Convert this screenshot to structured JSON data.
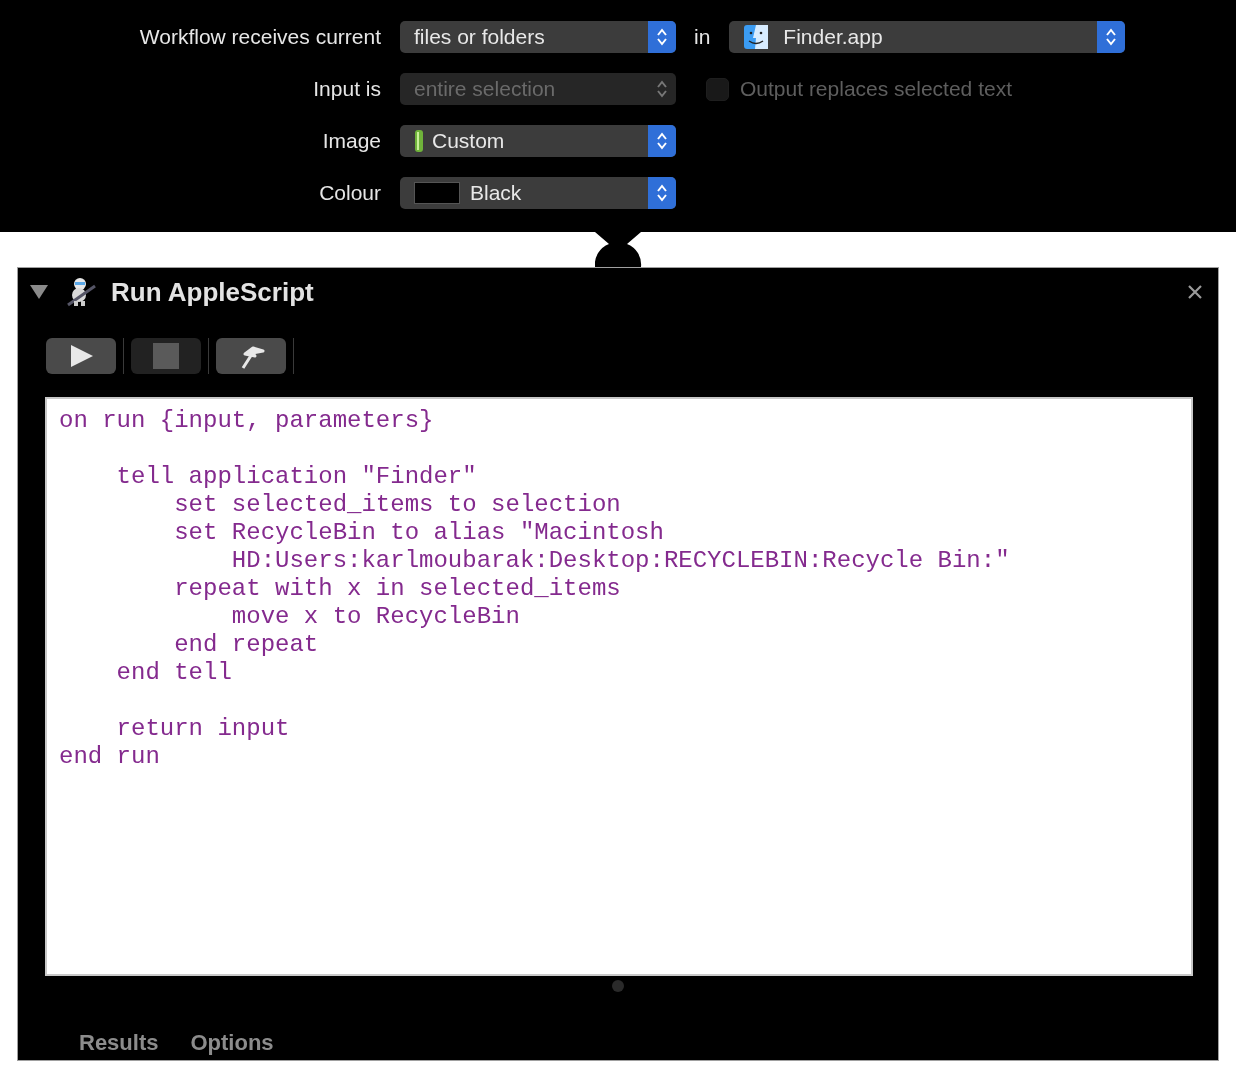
{
  "settings": [
    {
      "label": "Workflow receives current",
      "popup": {
        "kind": "plain",
        "value": "files or folders",
        "disabled": false
      },
      "trailing": {
        "kind": "popup",
        "label": "in",
        "value": "Finder.app",
        "disabled": false
      }
    },
    {
      "label": "Input is",
      "popup": {
        "kind": "plain",
        "value": "entire selection",
        "disabled": true
      },
      "trailing": {
        "kind": "checkbox",
        "label": "Output replaces selected text",
        "checked": false,
        "disabled": true
      }
    },
    {
      "label": "Image",
      "popup": {
        "kind": "image",
        "value": "Custom",
        "disabled": false
      }
    },
    {
      "label": "Colour",
      "popup": {
        "kind": "swatch",
        "value": "Black",
        "disabled": false
      }
    }
  ],
  "action": {
    "title": "Run AppleScript",
    "expanded": true,
    "toolbar": [
      {
        "kind": "run",
        "disabled": false
      },
      {
        "kind": "stop",
        "disabled": true
      },
      {
        "kind": "compile",
        "disabled": false
      }
    ],
    "code": [
      [
        "on run {input, parameters}"
      ],
      [
        "    tell application \"Finder\"",
        "        set selected_items to selection",
        "        set RecycleBin to alias \"Macintosh",
        "            HD:Users:karlmoubarak:Desktop:RECYCLEBIN:Recycle Bin:\"",
        "        repeat with x in selected_items",
        "            move x to RecycleBin",
        "        end repeat",
        "    end tell"
      ],
      [
        "    return input",
        "end run"
      ]
    ],
    "tabs": [
      {
        "label": "Results",
        "selected": false
      },
      {
        "label": "Options",
        "selected": false
      }
    ]
  }
}
